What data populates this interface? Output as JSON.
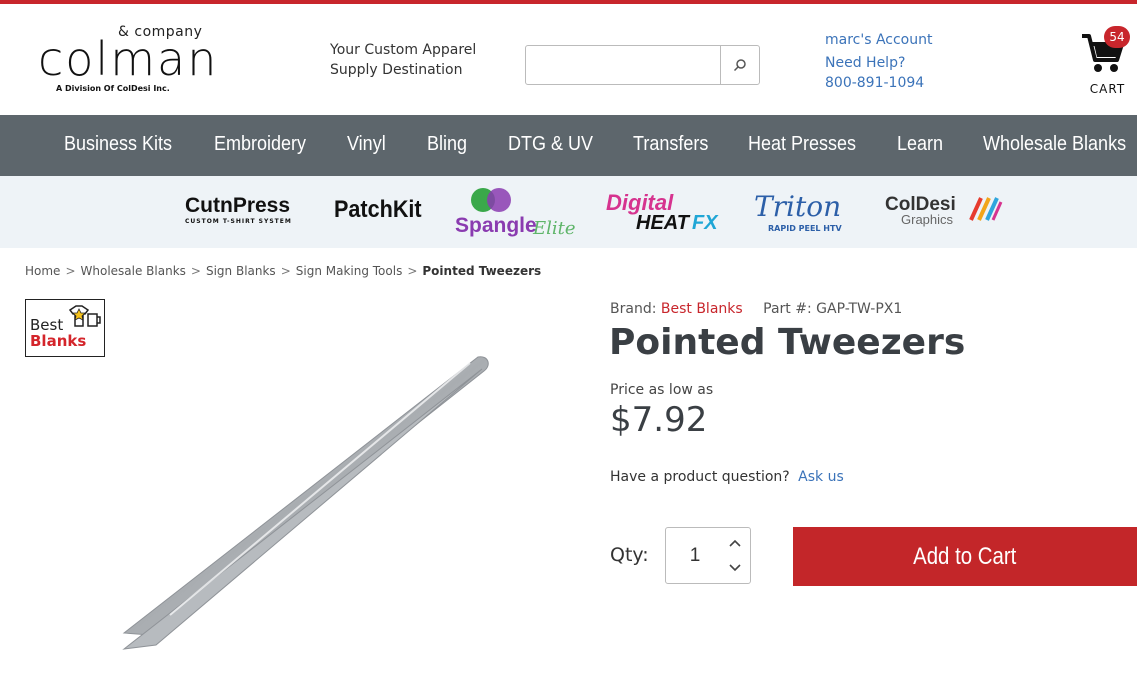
{
  "header": {
    "logo": {
      "ampersand": "& company",
      "name": "colman",
      "division": "A Division Of ColDesi Inc."
    },
    "tagline_line1": "Your Custom Apparel",
    "tagline_line2": "Supply Destination",
    "search": {
      "value": "",
      "placeholder": ""
    },
    "account_link": "marc's Account",
    "help_link": "Need Help?",
    "phone": "800-891-1094",
    "cart_count": "54",
    "cart_label": "CART"
  },
  "nav": {
    "items": [
      "Business Kits",
      "Embroidery",
      "Vinyl",
      "Bling",
      "DTG & UV",
      "Transfers",
      "Heat Presses",
      "Learn",
      "Wholesale Blanks"
    ]
  },
  "brands": {
    "cutnpress": {
      "name": "CutnPress",
      "sub": "CUSTOM T-SHIRT SYSTEM"
    },
    "patchkit": {
      "name": "PatchKit"
    },
    "spangle": {
      "name": "Spangle",
      "suffix": "Elite"
    },
    "digital": {
      "line1": "Digital",
      "line2": "HEAT",
      "line3": "FX"
    },
    "triton": {
      "name": "Triton",
      "sub": "RAPID PEEL HTV"
    },
    "coldesi": {
      "name": "ColDesi",
      "sub": "Graphics"
    }
  },
  "breadcrumb": [
    "Home",
    "Wholesale Blanks",
    "Sign Blanks",
    "Sign Making Tools",
    "Pointed Tweezers"
  ],
  "breadcrumb_sep": ">",
  "product": {
    "brand_logo_line1": "Best",
    "brand_logo_line2": "Blanks",
    "brand_label": "Brand:",
    "brand_name": "Best Blanks",
    "part_label": "Part #:",
    "part_number": "GAP-TW-PX1",
    "title": "Pointed Tweezers",
    "price_label": "Price as low as",
    "price": "$7.92",
    "question_text": "Have a product question?",
    "ask_link": "Ask us",
    "qty_label": "Qty:",
    "qty_value": "1",
    "add_to_cart": "Add to Cart"
  },
  "colors": {
    "accent_red": "#c32629",
    "nav_bg": "#5d666c",
    "link_blue": "#3b73b9",
    "brand_bar_bg": "#eef3f7"
  }
}
